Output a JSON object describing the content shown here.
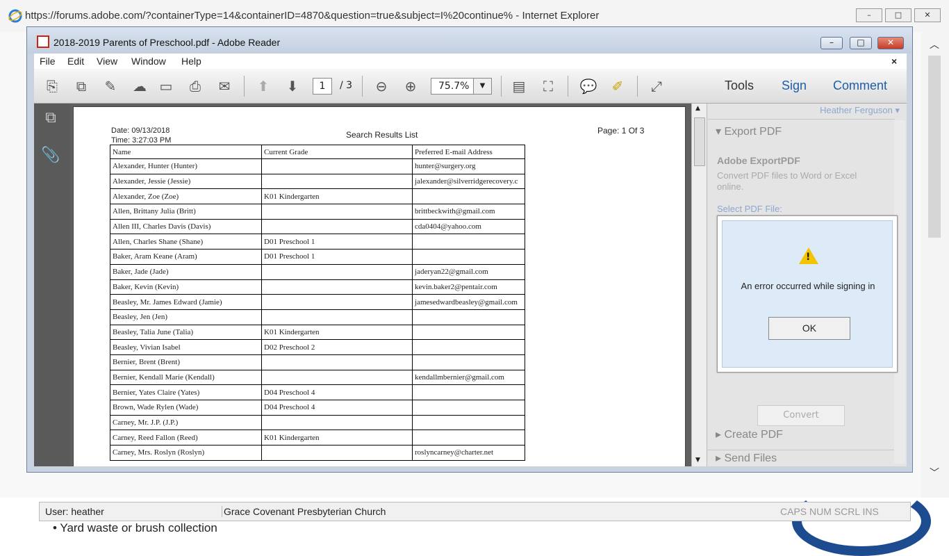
{
  "browser": {
    "title": "https://forums.adobe.com/?containerType=14&containerID=4870&question=true&subject=I%20continue% - Internet Explorer",
    "controls": [
      "–",
      "□",
      "✕"
    ]
  },
  "reader": {
    "title": "2018-2019 Parents of Preschool.pdf - Adobe Reader",
    "menu": [
      "File",
      "Edit",
      "View",
      "Window",
      "Help"
    ],
    "menu_close": "×",
    "page_current": "1",
    "page_total": "/ 3",
    "zoom": "75.7%",
    "tools_label": "Tools",
    "sign_label": "Sign",
    "comment_label": "Comment"
  },
  "document": {
    "date": "Date: 09/13/2018",
    "time": "Time: 3:27:03 PM",
    "title": "Search Results List",
    "page": "Page:  1 Of 3",
    "headers": [
      "Name",
      "Current Grade",
      "Preferred E-mail Address"
    ],
    "rows": [
      [
        "Alexander, Hunter (Hunter)",
        "",
        "hunter@surgery.org"
      ],
      [
        "Alexander, Jessie (Jessie)",
        "",
        "jalexander@silverridgerecovery.c"
      ],
      [
        "Alexander, Zoe (Zoe)",
        "K01 Kindergarten",
        ""
      ],
      [
        "Allen, Brittany Julia (Britt)",
        "",
        "brittbeckwith@gmail.com"
      ],
      [
        "Allen  III, Charles Davis (Davis)",
        "",
        "cda0404@yahoo.com"
      ],
      [
        "Allen, Charles Shane (Shane)",
        "D01 Preschool 1",
        ""
      ],
      [
        "Baker, Aram Keane (Aram)",
        "D01 Preschool 1",
        ""
      ],
      [
        "Baker, Jade (Jade)",
        "",
        "jaderyan22@gmail.com"
      ],
      [
        "Baker, Kevin (Kevin)",
        "",
        "kevin.baker2@pentair.com"
      ],
      [
        "Beasley, Mr. James Edward (Jamie)",
        "",
        "jamesedwardbeasley@gmail.com"
      ],
      [
        "Beasley, Jen (Jen)",
        "",
        ""
      ],
      [
        "Beasley, Talia June (Talia)",
        "K01 Kindergarten",
        ""
      ],
      [
        "Beasley, Vivian Isabel",
        "D02 Preschool 2",
        ""
      ],
      [
        "Bernier, Brent (Brent)",
        "",
        ""
      ],
      [
        "Bernier, Kendall Marie (Kendall)",
        "",
        "kendallmbernier@gmail.com"
      ],
      [
        "Bernier, Yates Claire (Yates)",
        "D04 Preschool 4",
        ""
      ],
      [
        "Brown, Wade Rylen (Wade)",
        "D04 Preschool 4",
        ""
      ],
      [
        "Carney, Mr. J.P. (J.P.)",
        "",
        ""
      ],
      [
        "Carney, Reed Fallon (Reed)",
        "K01 Kindergarten",
        ""
      ],
      [
        "Carney, Mrs. Roslyn (Roslyn)",
        "",
        "roslyncarney@charter.net"
      ]
    ]
  },
  "panel": {
    "user": "Heather Ferguson",
    "export_pdf": "Export PDF",
    "adobe_export": "Adobe ExportPDF",
    "convert_desc": "Convert PDF files to Word or Excel online.",
    "select_file": "Select PDF File:",
    "convert_btn": "Convert",
    "create_pdf": "Create PDF",
    "send_files": "Send Files"
  },
  "dialog": {
    "message": "An error occurred while signing in",
    "ok": "OK"
  },
  "status": {
    "user": "User: heather",
    "org": "Grace Covenant Presbyterian Church",
    "keys": "CAPS  NUM  SCRL  INS"
  },
  "background": {
    "bullet": "•   Yard waste or brush collection"
  }
}
